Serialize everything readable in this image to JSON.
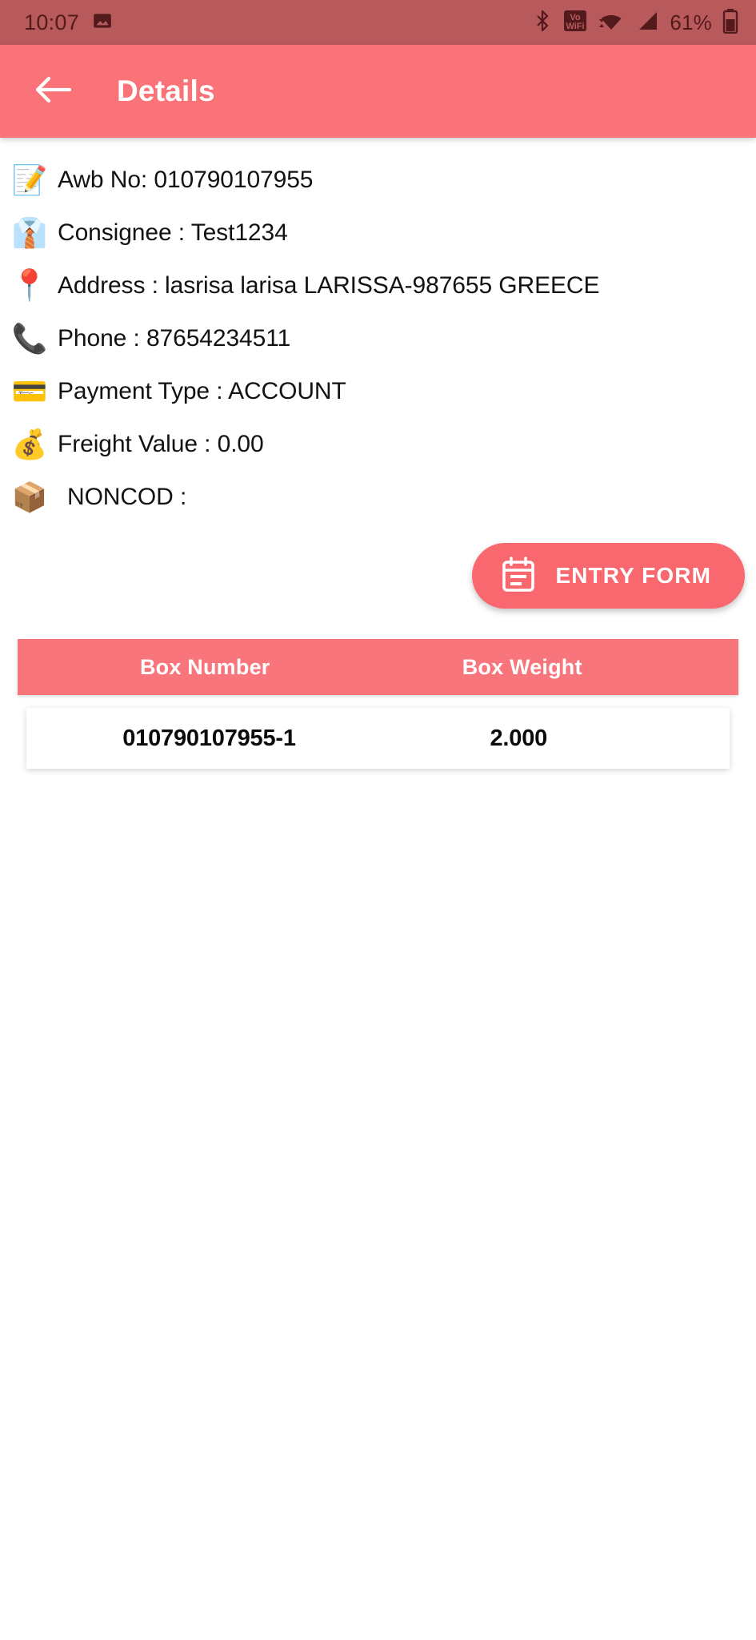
{
  "status_bar": {
    "time": "10:07",
    "battery_percent": "61%",
    "icons": [
      "image-notification-icon",
      "bluetooth-icon",
      "volte-wifi-icon",
      "wifi-icon",
      "cellular-signal-icon",
      "battery-icon"
    ],
    "background_color": "#b8595c",
    "foreground_color": "#521a1c"
  },
  "app_bar": {
    "title": "Details",
    "back_icon": "arrow-left-icon",
    "background_color": "#fa7378",
    "text_color": "#ffffff"
  },
  "details": [
    {
      "icon": "memo-icon",
      "glyph": "📝",
      "text": "Awb No:  010790107955"
    },
    {
      "icon": "businessman-icon",
      "glyph": "👔",
      "text": "Consignee : Test1234"
    },
    {
      "icon": "location-pin-icon",
      "glyph": "📍",
      "text": "Address :  lasrisa larisa LARISSA-987655 GREECE"
    },
    {
      "icon": "telephone-icon",
      "glyph": "📞",
      "text": "Phone : 87654234511"
    },
    {
      "icon": "credit-card-icon",
      "glyph": "💳",
      "text": "Payment Type : ACCOUNT"
    },
    {
      "icon": "money-growth-icon",
      "glyph": "💰",
      "text": "Freight Value : 0.00"
    },
    {
      "icon": "cod-package-icon",
      "glyph": "📦",
      "text": "NONCOD :"
    }
  ],
  "entry_form_button": {
    "label": "ENTRY FORM",
    "icon": "calendar-form-icon",
    "background_color": "#f9686f",
    "text_color": "#ffffff"
  },
  "box_table": {
    "header_background_color": "#f9757c",
    "columns": [
      "Box Number",
      "Box Weight"
    ],
    "rows": [
      {
        "box_number": "010790107955-1",
        "box_weight": "2.000"
      }
    ]
  }
}
